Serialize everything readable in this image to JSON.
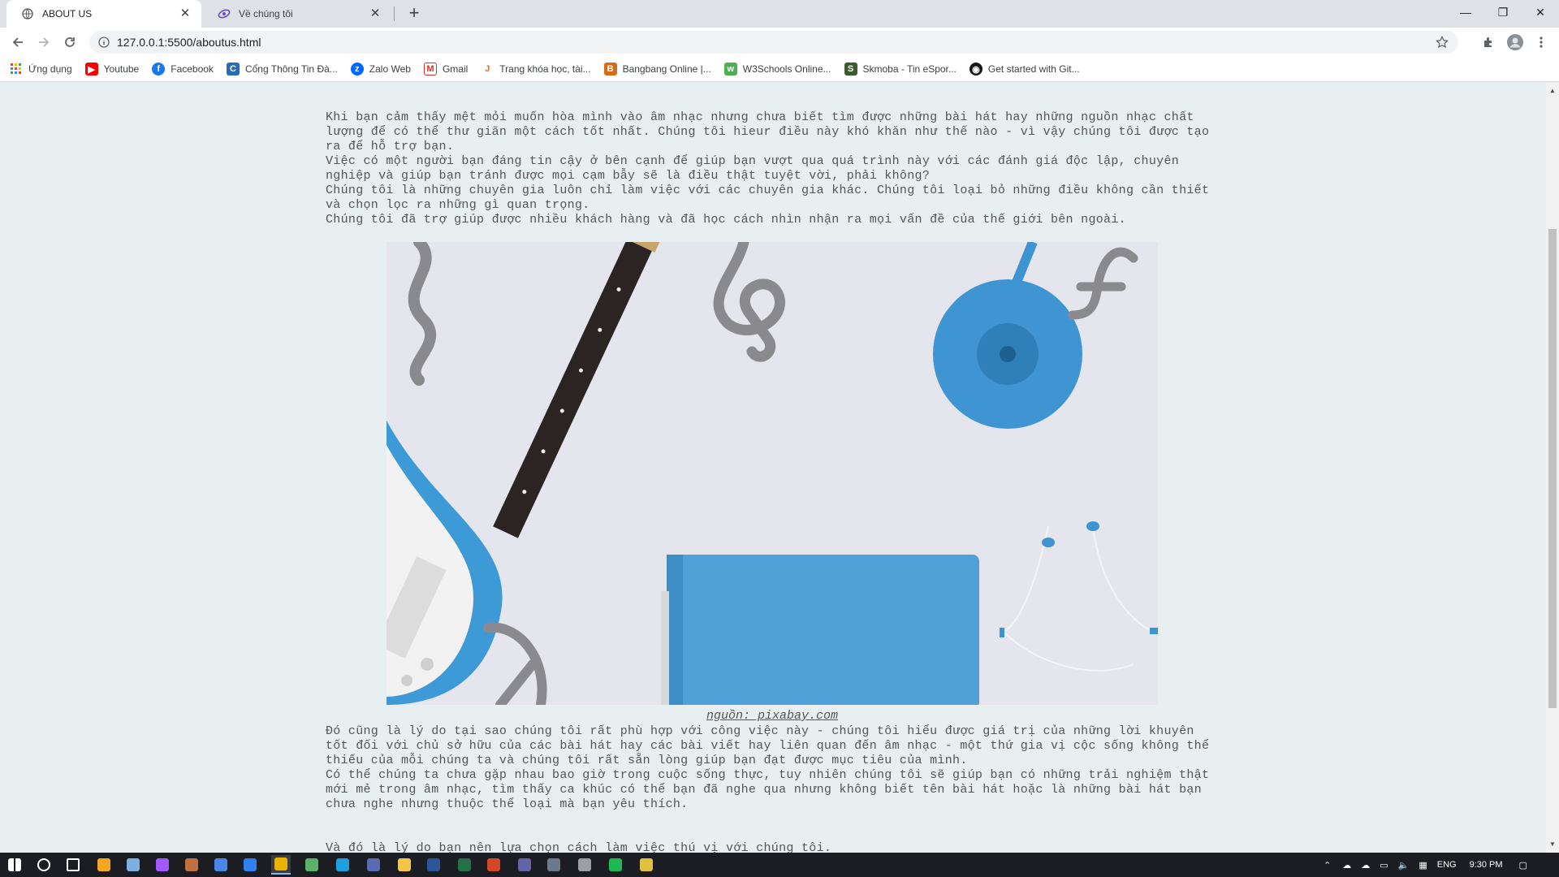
{
  "browser": {
    "tabs": [
      {
        "title": "ABOUT US",
        "active": true
      },
      {
        "title": "Về chúng tôi",
        "active": false
      }
    ],
    "url": "127.0.0.1:5500/aboutus.html",
    "window_controls": {
      "minimize": "—",
      "restore": "❐",
      "close": "✕"
    }
  },
  "bookmarks": [
    {
      "label": "Ứng dụng",
      "icon": "apps-grid-icon",
      "color": "#e8453c"
    },
    {
      "label": "Youtube",
      "icon": "youtube-icon",
      "color": "#ff0000"
    },
    {
      "label": "Facebook",
      "icon": "facebook-icon",
      "color": "#1877f2"
    },
    {
      "label": "Cổng Thông Tin Đà...",
      "icon": "portal-icon",
      "color": "#2a6bb8"
    },
    {
      "label": "Zalo Web",
      "icon": "zalo-icon",
      "color": "#0068ff"
    },
    {
      "label": "Gmail",
      "icon": "gmail-icon",
      "color": "#d93025"
    },
    {
      "label": "Trang khóa học, tài...",
      "icon": "course-icon",
      "color": "#e36f1e"
    },
    {
      "label": "Bangbang Online |...",
      "icon": "bangbang-icon",
      "color": "#d66c1a"
    },
    {
      "label": "W3Schools Online...",
      "icon": "w3schools-icon",
      "color": "#4caf50"
    },
    {
      "label": "Skmoba - Tin eSpor...",
      "icon": "skmoba-icon",
      "color": "#3c5a2a"
    },
    {
      "label": "Get started with Git...",
      "icon": "github-icon",
      "color": "#181717"
    }
  ],
  "page": {
    "intro_paragraphs": [
      "Khi bạn cảm thấy mệt mỏi muốn hòa mình vào âm nhạc nhưng chưa biết tìm được những bài hát hay những nguồn nhạc chất lượng để có thể thư giãn một cách tốt nhất. Chúng tôi hieur điều này khó khăn như thế nào - vì vậy chúng tôi được tạo ra để hỗ trợ bạn.",
      "Việc có một người bạn đáng tin cậy ở bên cạnh để giúp bạn vượt qua quá trình này với các đánh giá độc lập, chuyên nghiệp và giúp bạn tránh được mọi cạm bẫy sẽ là điều thật tuyệt vời, phải không?",
      "Chúng tôi là những chuyên gia luôn chỉ làm việc với các chuyên gia khác. Chúng tôi loại bỏ những điều không cần thiết và chọn lọc ra những gì quan trọng.",
      "Chúng tôi đã trợ giúp được nhiều khách hàng và đã học cách nhìn nhận ra mọi vấn đề của thế giới bên ngoài."
    ],
    "image_caption": "nguồn: pixabay.com",
    "body_paragraphs": [
      "Đó cũng là lý do tại sao chúng tôi rất phù hợp với công việc này - chúng tôi hiểu được giá trị của những lời khuyên tốt đối với chủ sở hữu của các bài hát hay các bài viết hay liên quan đến âm nhạc - một thứ gia vị cộc sống không thể thiếu của mỗi chúng ta và chúng tôi rất sẵn lòng giúp bạn đạt được mục tiêu của mình.",
      "Có thể chúng ta chưa gặp nhau bao giờ trong cuộc sống thực, tuy nhiên chúng tôi sẽ giúp bạn có những trải nghiệm thật mới mẻ trong âm nhạc, tìm thấy ca khúc có thể bạn đã nghe qua nhưng không biết tên bài hát hoặc là những bài hát bạn chưa nghe nhưng thuộc thể loại mà bạn yêu thích."
    ],
    "closing": "Và đó là lý do bạn nên lựa chọn cách làm việc thú vị với chúng tôi."
  },
  "taskbar": {
    "apps": [
      {
        "icon": "start-icon",
        "color": "#ffffff"
      },
      {
        "icon": "search-icon",
        "color": "#ffffff"
      },
      {
        "icon": "task-view-icon",
        "color": "#ffffff"
      },
      {
        "icon": "app-orange-icon",
        "color": "#f5a623"
      },
      {
        "icon": "paint-icon",
        "color": "#7bb0e0"
      },
      {
        "icon": "messenger-icon",
        "color": "#a259ff"
      },
      {
        "icon": "game-icon",
        "color": "#c07040"
      },
      {
        "icon": "mail-app-icon",
        "color": "#4a86e8"
      },
      {
        "icon": "vscode-icon",
        "color": "#2f80ed"
      },
      {
        "icon": "chrome-icon",
        "color": "#e8b400"
      },
      {
        "icon": "app-green-icon",
        "color": "#58b368"
      },
      {
        "icon": "edge-icon",
        "color": "#1ba1e2"
      },
      {
        "icon": "app-window-icon",
        "color": "#5a6bb5"
      },
      {
        "icon": "file-explorer-icon",
        "color": "#f3c64a"
      },
      {
        "icon": "word-icon",
        "color": "#2b579a"
      },
      {
        "icon": "excel-icon",
        "color": "#217346"
      },
      {
        "icon": "powerpoint-icon",
        "color": "#d24726"
      },
      {
        "icon": "teams-icon",
        "color": "#6264a7"
      },
      {
        "icon": "calculator-icon",
        "color": "#6a7a8a"
      },
      {
        "icon": "app-cloud-icon",
        "color": "#9aa0a6"
      },
      {
        "icon": "spotify-icon",
        "color": "#1db954"
      },
      {
        "icon": "app-yellow-icon",
        "color": "#e0c040"
      }
    ],
    "language": "ENG",
    "time": "9:30 PM"
  }
}
